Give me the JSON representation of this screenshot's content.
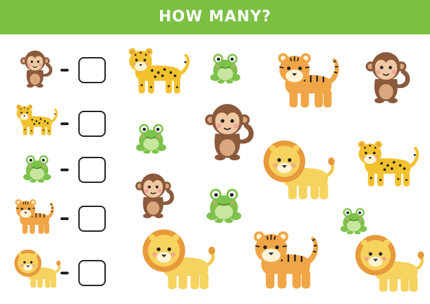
{
  "header": {
    "title": "HOW MANY?",
    "background_color": "#7bc043",
    "text_color": "#ffffff"
  },
  "legend": {
    "rows": [
      {
        "animal": "monkey",
        "icon": "monkey-icon",
        "answer": ""
      },
      {
        "animal": "leopard",
        "icon": "leopard-icon",
        "answer": ""
      },
      {
        "animal": "frog",
        "icon": "frog-icon",
        "answer": ""
      },
      {
        "animal": "tiger",
        "icon": "tiger-icon",
        "answer": ""
      },
      {
        "animal": "lion",
        "icon": "lion-icon",
        "answer": ""
      }
    ]
  },
  "scene": {
    "animals": [
      "leopard",
      "frog",
      "tiger",
      "monkey",
      "frog",
      "monkey",
      "leopard",
      "lion",
      "monkey",
      "frog",
      "frog",
      "lion",
      "tiger",
      "lion"
    ]
  }
}
